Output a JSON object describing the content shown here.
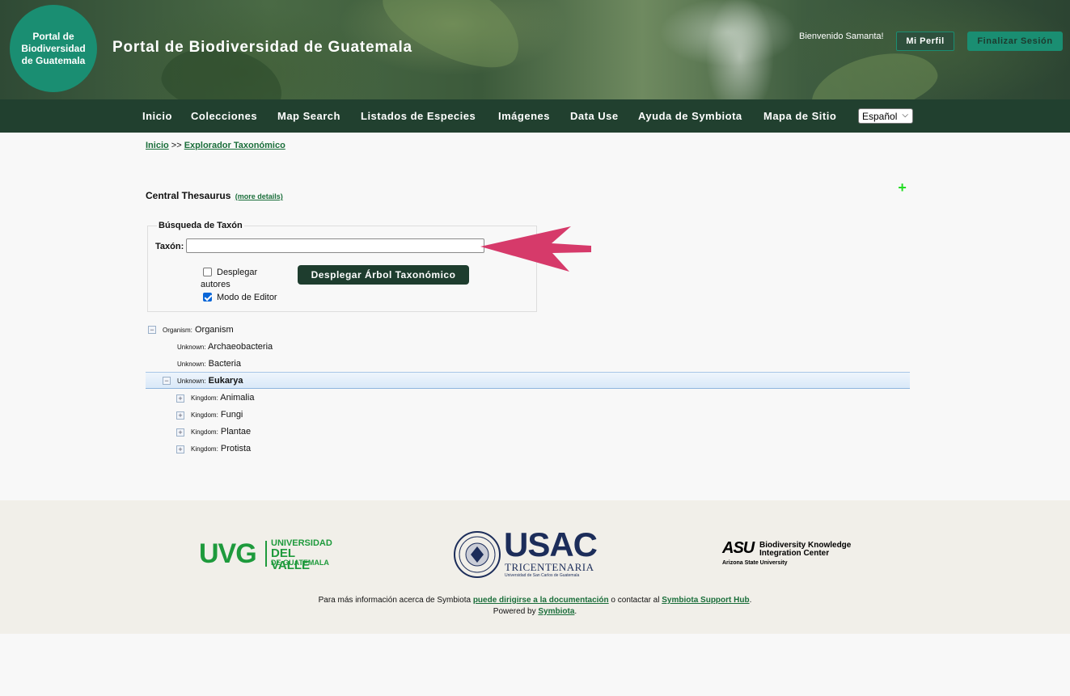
{
  "header": {
    "logo_text": "Portal de\nBiodiversidad\nde Guatemala",
    "site_title": "Portal de Biodiversidad de Guatemala",
    "welcome": "Bienvenido Samanta!",
    "profile_button": "Mi Perfil",
    "logout_button": "Finalizar Sesión"
  },
  "nav": {
    "items": [
      "Inicio",
      "Colecciones",
      "Map Search",
      "Listados de Especies",
      "Imágenes",
      "Data Use",
      "Ayuda de Symbiota",
      "Mapa de Sitio"
    ],
    "language": "Español"
  },
  "breadcrumb": {
    "home": "Inicio",
    "separator": ">>",
    "current": "Explorador Taxonómico"
  },
  "thesaurus": {
    "title": "Central Thesaurus",
    "details_link": "(more details)"
  },
  "search": {
    "legend": "Búsqueda de Taxón",
    "taxon_label": "Taxón:",
    "taxon_value": "",
    "show_authors_label_1": "Desplegar",
    "show_authors_label_2": "autores",
    "show_authors_checked": false,
    "editor_mode_label": "Modo de Editor",
    "editor_mode_checked": true,
    "display_tree_button": "Desplegar Árbol Taxonómico"
  },
  "tree": {
    "root": {
      "rank": "Organism:",
      "name": "Organism"
    },
    "children": [
      {
        "rank": "Unknown:",
        "name": "Archaeobacteria"
      },
      {
        "rank": "Unknown:",
        "name": "Bacteria"
      },
      {
        "rank": "Unknown:",
        "name": "Eukarya"
      }
    ],
    "kingdoms": [
      {
        "rank": "Kingdom:",
        "name": "Animalia"
      },
      {
        "rank": "Kingdom:",
        "name": "Fungi"
      },
      {
        "rank": "Kingdom:",
        "name": "Plantae"
      },
      {
        "rank": "Kingdom:",
        "name": "Protista"
      }
    ]
  },
  "footer": {
    "uvg": {
      "short": "UVG",
      "line1": "UNIVERSIDAD",
      "line2": "DEL VALLE",
      "line3": "DE GUATEMALA"
    },
    "usac": {
      "short": "USAC",
      "line1": "TRICENTENARIA",
      "line2": "Universidad de San Carlos de Guatemala"
    },
    "asu": {
      "short": "ASU",
      "line1": "Biodiversity Knowledge",
      "line2": "Integration Center",
      "line3": "Arizona State University"
    },
    "info_prefix": "Para más información acerca de Symbiota ",
    "doc_link": "puede dirigirse a la documentación",
    "info_middle": " o contactar al ",
    "support_link": "Symbiota Support Hub",
    "info_suffix": ".",
    "powered_prefix": "Powered by ",
    "powered_link": "Symbiota",
    "powered_suffix": "."
  },
  "colors": {
    "brand_green": "#1a8e72",
    "nav_bg": "#21402f",
    "link_green": "#1a6e3a",
    "annotation_arrow": "#d63a6a"
  }
}
